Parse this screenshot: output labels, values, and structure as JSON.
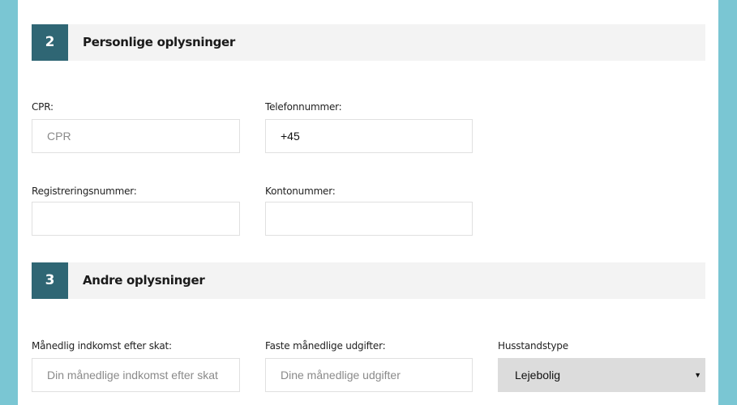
{
  "sections": [
    {
      "number": "2",
      "title": "Personlige oplysninger"
    },
    {
      "number": "3",
      "title": "Andre oplysninger"
    }
  ],
  "personal": {
    "cpr_label": "CPR:",
    "cpr_placeholder": "CPR",
    "cpr_value": "",
    "phone_label": "Telefonnummer:",
    "phone_value": "+45",
    "reg_label": "Registreringsnummer:",
    "reg_value": "",
    "account_label": "Kontonummer:",
    "account_value": ""
  },
  "other": {
    "income_label": "Månedlig indkomst efter skat:",
    "income_placeholder": "Din månedlige indkomst efter skat",
    "expenses_label": "Faste månedlige udgifter:",
    "expenses_placeholder": "Dine månedlige udgifter",
    "household_label": "Husstandstype",
    "household_selected": "Lejebolig",
    "household_caret": "▼"
  },
  "colors": {
    "page_background": "#7ac6d3",
    "section_number_bg": "#2f6674",
    "section_header_bg": "#f3f3f3",
    "select_bg": "#dcdcdc"
  }
}
